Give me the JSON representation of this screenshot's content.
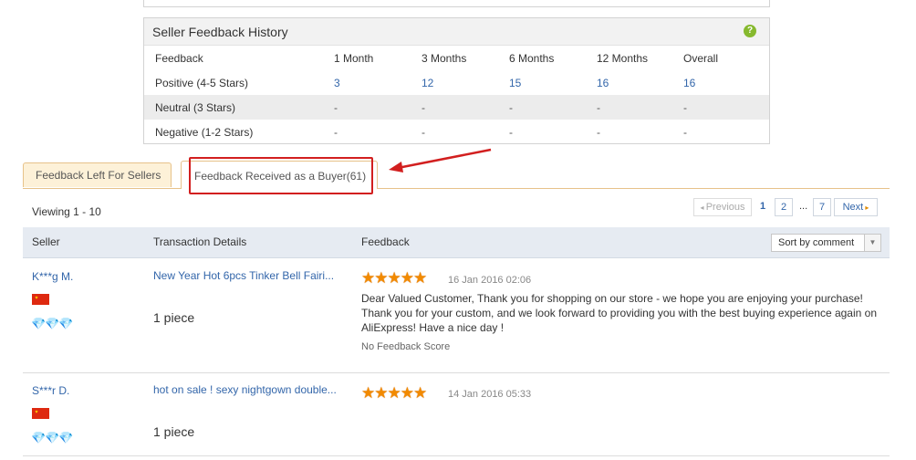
{
  "history": {
    "title": "Seller Feedback History",
    "columns": [
      "Feedback",
      "1 Month",
      "3 Months",
      "6 Months",
      "12 Months",
      "Overall"
    ],
    "rows": [
      {
        "label": "Positive (4-5 Stars)",
        "values": [
          "3",
          "12",
          "15",
          "16",
          "16"
        ]
      },
      {
        "label": "Neutral (3 Stars)",
        "values": [
          "-",
          "-",
          "-",
          "-",
          "-"
        ]
      },
      {
        "label": "Negative (1-2 Stars)",
        "values": [
          "-",
          "-",
          "-",
          "-",
          "-"
        ]
      }
    ]
  },
  "tabs": {
    "left_for_sellers": "Feedback Left For Sellers",
    "received_as_buyer": "Feedback Received as a Buyer(61)"
  },
  "viewing": "Viewing 1 - 10",
  "pager": {
    "previous": "Previous",
    "current": "1",
    "page2": "2",
    "ellipsis": "...",
    "last": "7",
    "next": "Next"
  },
  "table": {
    "headers": {
      "seller": "Seller",
      "transaction": "Transaction Details",
      "feedback": "Feedback"
    },
    "sort_label": "Sort by comment"
  },
  "entries": [
    {
      "buyer": "K***g M.",
      "diamonds": "💎💎💎",
      "product": "New Year Hot 6pcs Tinker Bell Fairi...",
      "quantity": "1 piece",
      "stars": "★★★★★",
      "date": "16 Jan 2016 02:06",
      "comment": "Dear Valued Customer, Thank you for shopping on our store - we hope you are enjoying your purchase! Thank you for your custom, and we look forward to providing you with the best buying experience again on AliExpress! Have a nice day !",
      "score_note": "No Feedback Score"
    },
    {
      "buyer": "S***r D.",
      "diamonds": "💎💎💎",
      "product": "hot on sale ! sexy nightgown double...",
      "quantity": "1 piece",
      "stars": "★★★★★",
      "date": "14 Jan 2016 05:33"
    }
  ],
  "colors": {
    "link": "#3366aa",
    "tab_border": "#e7c28a",
    "highlight": "#d21f1f",
    "star": "#f28a00"
  }
}
